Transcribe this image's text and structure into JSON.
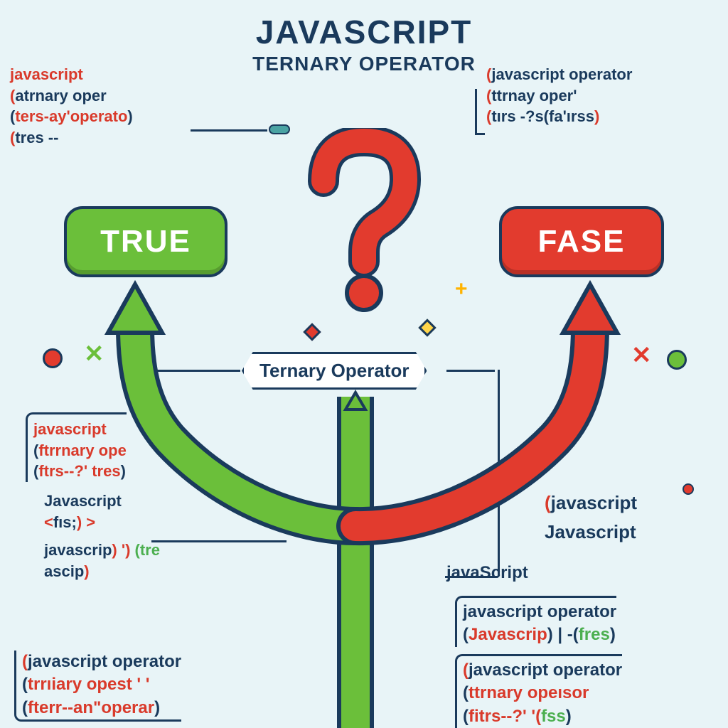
{
  "title": "JAVASCRIPT",
  "subtitle": "TERNARY OPERATOR",
  "true_label": "TRUE",
  "false_label": "FASE",
  "center_chip": "Ternary Operator",
  "top_left": {
    "l1a": "javascript",
    "l2a": "(",
    "l2b": "atrnary oper",
    "l3a": "(",
    "l3b": "ters-ay'operato",
    "l3c": ")",
    "l4a": "(",
    "l4b": "tres --"
  },
  "top_right": {
    "l1a": "(",
    "l1b": "javascript operator",
    "l2a": "(",
    "l2b": "ttrnay oper'",
    "l3a": "(",
    "l3b": "tırs -?s(fa'ırss",
    "l3c": ")"
  },
  "left_mid": {
    "l1": "javascript",
    "l2a": "(",
    "l2b": "ftrrnary ope",
    "l3a": "(",
    "l3b": "ftrs--?'  tres",
    "l3c": ")",
    "l4": "Javascript",
    "l5a": "<",
    "l5b": "fıs;",
    "l5c": ")  >",
    "l6a": "javascrip",
    "l6b": ")  ') ",
    "l6c": "(tre",
    "l7": "ascip",
    "l7b": ")"
  },
  "left_bot": {
    "l1a": "(",
    "l1b": "javascript operator",
    "l2a": "(",
    "l2b": "trrıiary opest  ' '",
    "l3a": "(",
    "l3b": "fterr--an\"operar",
    "l3c": ")"
  },
  "right_mid": {
    "l1a": "(",
    "l1b": "javascript",
    "l2": "Javascript",
    "l3": "javaScript"
  },
  "right_bot1": {
    "l1": "javascript operator",
    "l2a": "(",
    "l2b": "Javascrip",
    "l2c": ") |  -(",
    "l2d": "fres",
    "l2e": ")"
  },
  "right_bot2": {
    "l1a": "(",
    "l1b": "javascript operator",
    "l2a": "(",
    "l2b": "ttrnary opeısor",
    "l3a": "(",
    "l3b": "fitrs--?' '(",
    "l3c": "fss",
    "l3d": ")"
  }
}
